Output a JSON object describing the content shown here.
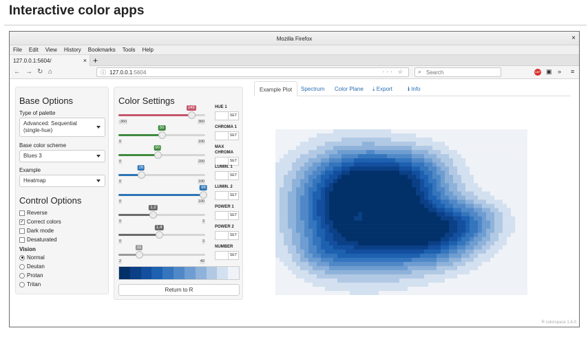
{
  "page": {
    "heading": "Interactive color apps"
  },
  "browser": {
    "window_title": "Mozilla Firefox",
    "close_glyph": "×",
    "menu": [
      "File",
      "Edit",
      "View",
      "History",
      "Bookmarks",
      "Tools",
      "Help"
    ],
    "tab_title": "127.0.0.1:5604/",
    "tab_close": "×",
    "new_tab": "+",
    "url_host": "127.0.0.1",
    "url_port": ":5604",
    "url_actions": "··· ☆",
    "search_placeholder": "Search",
    "abp_label": "ABP"
  },
  "base_options": {
    "title": "Base Options",
    "palette_type_label": "Type of palette",
    "palette_type_value": "Advanced: Sequential (single-hue)",
    "scheme_label": "Base color scheme",
    "scheme_value": "Blues 3",
    "example_label": "Example",
    "example_value": "Heatmap"
  },
  "control_options": {
    "title": "Control Options",
    "checkboxes": [
      {
        "label": "Reverse",
        "checked": false
      },
      {
        "label": "Correct colors",
        "checked": true
      },
      {
        "label": "Dark mode",
        "checked": false
      },
      {
        "label": "Desaturated",
        "checked": false
      }
    ],
    "vision_label": "Vision",
    "vision": [
      {
        "label": "Normal",
        "selected": true
      },
      {
        "label": "Deutan",
        "selected": false
      },
      {
        "label": "Protan",
        "selected": false
      },
      {
        "label": "Tritan",
        "selected": false
      }
    ]
  },
  "color_settings": {
    "title": "Color Settings",
    "sliders": [
      {
        "name": "HUE 1",
        "min": "-360",
        "max": "360",
        "value": "245",
        "fraction": 0.84,
        "color": "#c4566b"
      },
      {
        "name": "CHROMA 1",
        "min": "0",
        "max": "100",
        "value": "50",
        "fraction": 0.5,
        "color": "#3f8a3f"
      },
      {
        "name": "MAX CHROMA",
        "min": "0",
        "max": "200",
        "value": "90",
        "fraction": 0.45,
        "color": "#3f8a3f"
      },
      {
        "name": "LUMIN. 1",
        "min": "0",
        "max": "100",
        "value": "26",
        "fraction": 0.26,
        "color": "#2e74b5"
      },
      {
        "name": "LUMIN. 2",
        "min": "0",
        "max": "100",
        "value": "98",
        "fraction": 0.98,
        "color": "#2e74b5"
      },
      {
        "name": "POWER 1",
        "min": "0",
        "max": "3",
        "value": "1.2",
        "fraction": 0.4,
        "color": "#6b6b6b"
      },
      {
        "name": "POWER 2",
        "min": "0",
        "max": "3",
        "value": "1.4",
        "fraction": 0.47,
        "color": "#6b6b6b"
      },
      {
        "name": "NUMBER",
        "min": "2",
        "max": "40",
        "value": "11",
        "fraction": 0.24,
        "color": "#9a9a9a"
      }
    ],
    "set_label": "SET",
    "palette": [
      "#023069",
      "#0b3f86",
      "#134f9e",
      "#1d61b0",
      "#3475bd",
      "#5088c7",
      "#6e9dd1",
      "#8fb2da",
      "#b1c9e4",
      "#d3e0ef",
      "#eff2f7"
    ],
    "return_label": "Return to R"
  },
  "plot_tabs": [
    {
      "label": "Example Plot",
      "icon": "",
      "active": true
    },
    {
      "label": "Spectrum",
      "icon": "",
      "active": false
    },
    {
      "label": "Color Plane",
      "icon": "",
      "active": false
    },
    {
      "label": "Export",
      "icon": "⤓",
      "active": false
    },
    {
      "label": "Info",
      "icon": "ℹ",
      "active": false
    }
  ],
  "credit": "R colorspace 1.4-0"
}
